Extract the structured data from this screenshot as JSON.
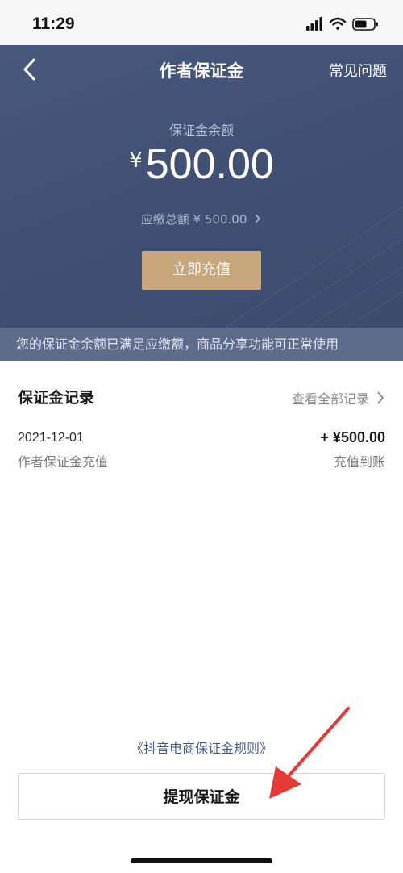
{
  "status_bar": {
    "time": "11:29"
  },
  "nav": {
    "title": "作者保证金",
    "faq_label": "常见问题"
  },
  "balance": {
    "label": "保证金余额",
    "currency": "¥",
    "amount": "500.00",
    "due_label": "应缴总额 ¥ 500.00"
  },
  "recharge_label": "立即充值",
  "notice": "您的保证金余额已满足应缴额，商品分享功能可正常使用",
  "records": {
    "title": "保证金记录",
    "view_all": "查看全部记录",
    "items": [
      {
        "date": "2021-12-01",
        "desc": "作者保证金充值",
        "amount": "+ ¥500.00",
        "status": "充值到账"
      }
    ]
  },
  "rules_link": "《抖音电商保证金规则》",
  "withdraw_label": "提现保证金",
  "colors": {
    "header_bg": "#3f4f73",
    "accent_gold": "#c7a77b",
    "notice_bg": "#5e6b8b",
    "link": "#4b5c88",
    "annotation_arrow": "#e53935"
  }
}
